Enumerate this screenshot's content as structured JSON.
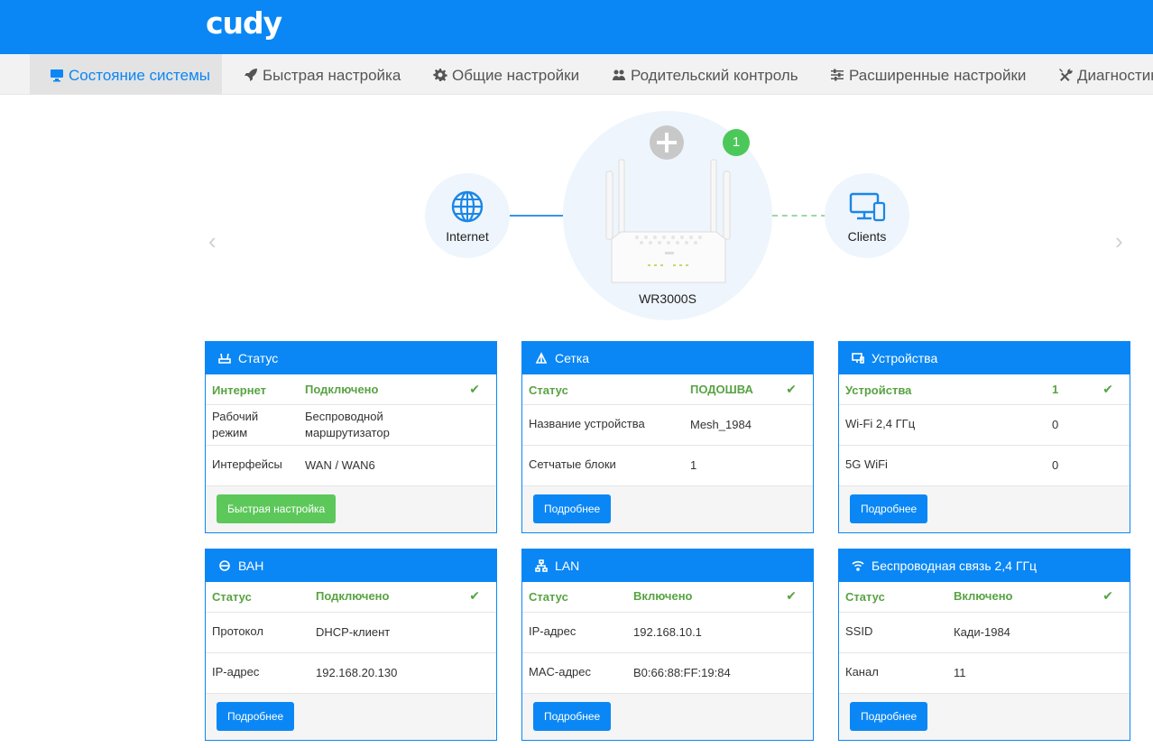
{
  "app": {
    "logo": "cudy"
  },
  "nav": {
    "items": [
      {
        "label": "Состояние системы",
        "icon": "monitor-icon",
        "active": true
      },
      {
        "label": "Быстрая настройка",
        "icon": "rocket-icon"
      },
      {
        "label": "Общие настройки",
        "icon": "gear-icon"
      },
      {
        "label": "Родительский контроль",
        "icon": "users-icon"
      },
      {
        "label": "Расширенные настройки",
        "icon": "sliders-icon"
      },
      {
        "label": "Диагностика",
        "icon": "tools-icon"
      }
    ]
  },
  "topology": {
    "internet_label": "Internet",
    "router_label": "WR3000S",
    "clients_label": "Clients",
    "clients_badge": "1"
  },
  "cards": {
    "status": {
      "title": "Статус",
      "rows": [
        {
          "k": "Интернет",
          "v": "Подключено"
        },
        {
          "k": "Рабочий режим",
          "v": "Беспроводной маршрутизатор"
        },
        {
          "k": "Интерфейсы",
          "v": "WAN / WAN6"
        }
      ],
      "button": "Быстрая настройка"
    },
    "mesh": {
      "title": "Сетка",
      "rows": [
        {
          "k": "Статус",
          "v": "ПОДОШВА"
        },
        {
          "k": "Название устройства",
          "v": "Mesh_1984"
        },
        {
          "k": "Сетчатые блоки",
          "v": "1"
        }
      ],
      "button": "Подробнее"
    },
    "devices": {
      "title": "Устройства",
      "rows": [
        {
          "k": "Устройства",
          "v": "1"
        },
        {
          "k": "Wi-Fi 2,4 ГГц",
          "v": "0"
        },
        {
          "k": "5G WiFi",
          "v": "0"
        }
      ],
      "button": "Подробнее"
    },
    "wan": {
      "title": "ВАН",
      "rows": [
        {
          "k": "Статус",
          "v": "Подключено"
        },
        {
          "k": "Протокол",
          "v": "DHCP-клиент"
        },
        {
          "k": "IP-адрес",
          "v": "192.168.20.130"
        }
      ],
      "button": "Подробнее"
    },
    "lan": {
      "title": "LAN",
      "rows": [
        {
          "k": "Статус",
          "v": "Включено"
        },
        {
          "k": "IP-адрес",
          "v": "192.168.10.1"
        },
        {
          "k": "MAC-адрес",
          "v": "B0:66:88:FF:19:84"
        }
      ],
      "button": "Подробнее"
    },
    "wifi24": {
      "title": "Беспроводная связь 2,4 ГГц",
      "rows": [
        {
          "k": "Статус",
          "v": "Включено"
        },
        {
          "k": "SSID",
          "v": "Кади-1984"
        },
        {
          "k": "Канал",
          "v": "11"
        }
      ],
      "button": "Подробнее"
    }
  },
  "colors": {
    "brand": "#0a87f5",
    "ok": "#58a343",
    "button_green": "#5cc85a"
  }
}
